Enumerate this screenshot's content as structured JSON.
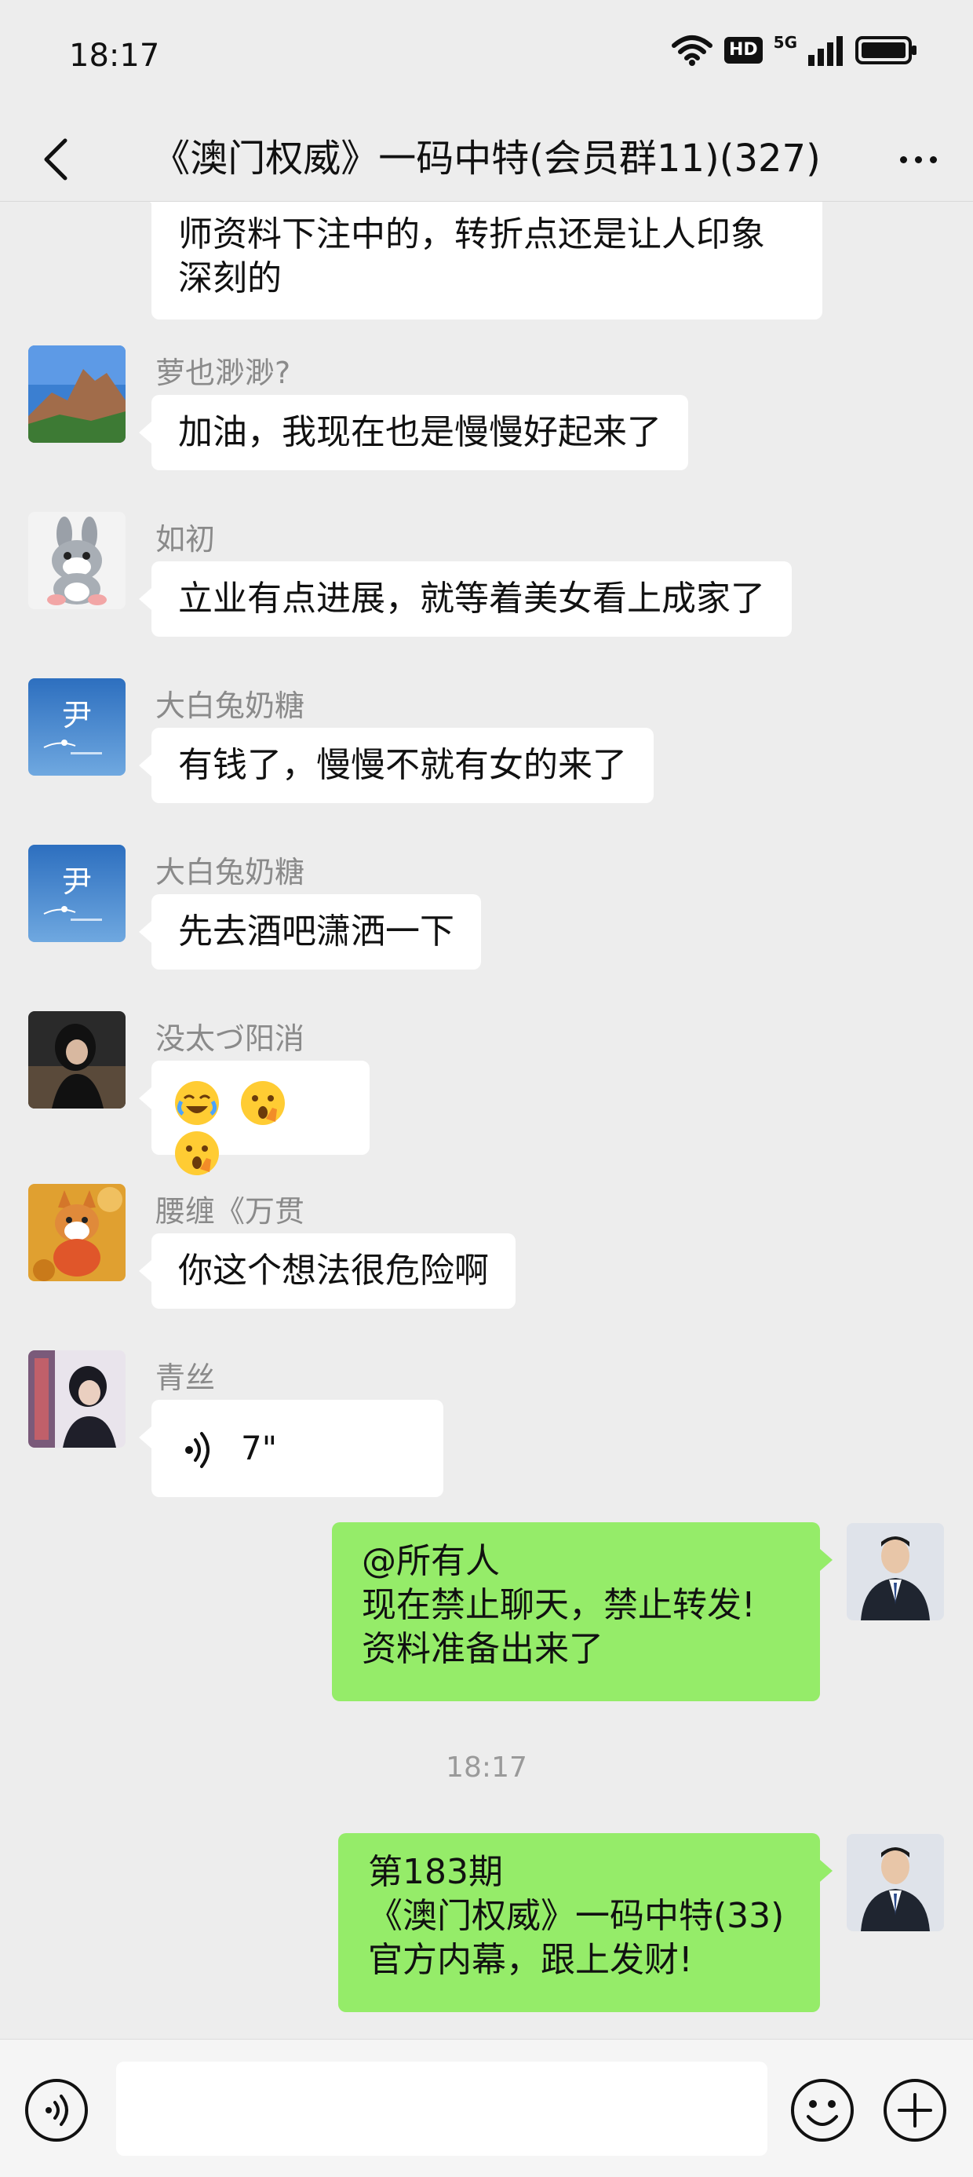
{
  "status_bar": {
    "time": "18:17",
    "network_badge": "HD",
    "network_type": "5G"
  },
  "header": {
    "title": "《澳门权威》一码中特(会员群11)(327)"
  },
  "messages": [
    {
      "side": "left",
      "sender": "",
      "lines": [
        "师资料下注中的，转折点还是让人印象",
        "深刻的"
      ]
    },
    {
      "side": "left",
      "sender": "萝也渺渺?",
      "text": "加油，我现在也是慢慢好起来了",
      "avatar": "mountain-avatar"
    },
    {
      "side": "left",
      "sender": "如初",
      "text": "立业有点进展，就等着美女看上成家了",
      "avatar": "rabbit-avatar"
    },
    {
      "side": "left",
      "sender": "大白兔奶糖",
      "text": "有钱了，慢慢不就有女的来了",
      "avatar": "sky-avatar"
    },
    {
      "side": "left",
      "sender": "大白兔奶糖",
      "text": "先去酒吧潇洒一下",
      "avatar": "sky-avatar"
    },
    {
      "side": "left",
      "sender": "没太づ阳消",
      "emojis": [
        "crying-laughing-emoji",
        "shocked-emoji",
        "shocked-emoji"
      ],
      "avatar": "girl-avatar"
    },
    {
      "side": "left",
      "sender": "腰缠《万贯",
      "text": "你这个想法很危险啊",
      "avatar": "dog-avatar"
    },
    {
      "side": "left",
      "sender": "青丝",
      "voice_duration": "7\"",
      "avatar": "person-avatar"
    },
    {
      "side": "right",
      "lines": [
        "@所有人",
        "现在禁止聊天，禁止转发!",
        "资料准备出来了"
      ],
      "avatar": "suit-man-avatar"
    },
    {
      "side": "right",
      "lines": [
        "第183期",
        "《澳门权威》一码中特(33)",
        "官方内幕，跟上发财!"
      ],
      "avatar": "suit-man-avatar"
    }
  ],
  "avatar_glyph": "尹",
  "timestamp": "18:17",
  "colors": {
    "self_bubble": "#95ec69",
    "other_bubble": "#ffffff",
    "background": "#ededed"
  },
  "input_bar": {
    "placeholder": ""
  }
}
